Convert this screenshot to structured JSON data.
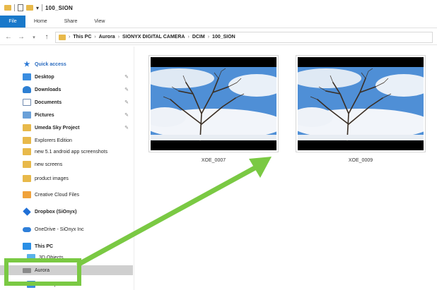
{
  "window": {
    "title": "100_SION"
  },
  "ribbon": {
    "tabs": [
      "File",
      "Home",
      "Share",
      "View"
    ]
  },
  "address": {
    "crumbs": [
      "This PC",
      "Aurora",
      "SIONYX DIGITAL CAMERA",
      "DCIM",
      "100_SION"
    ]
  },
  "sidebar": {
    "items": [
      {
        "label": "Quick access",
        "icon": "star-icon"
      },
      {
        "label": "Desktop",
        "icon": "desktop-icon",
        "pinned": true
      },
      {
        "label": "Downloads",
        "icon": "downloads-icon",
        "pinned": true
      },
      {
        "label": "Documents",
        "icon": "documents-icon",
        "pinned": true
      },
      {
        "label": "Pictures",
        "icon": "pictures-icon",
        "pinned": true
      },
      {
        "label": "Umeda Sky Project",
        "icon": "folder-icon",
        "pinned": true
      },
      {
        "label": "Explorers Edition",
        "icon": "folder-icon"
      },
      {
        "label": "new 5.1 android app screenshots",
        "icon": "folder-icon"
      },
      {
        "label": "new screens",
        "icon": "folder-icon"
      },
      {
        "label": "product images",
        "icon": "folder-icon"
      },
      {
        "label": "Creative Cloud Files",
        "icon": "creative-cloud-icon"
      },
      {
        "label": "Dropbox (SiOnyx)",
        "icon": "dropbox-icon"
      },
      {
        "label": "OneDrive - SiOnyx Inc",
        "icon": "onedrive-icon"
      },
      {
        "label": "This PC",
        "icon": "pc-icon"
      },
      {
        "label": "3D Objects",
        "icon": "3d-objects-icon"
      },
      {
        "label": "Aurora",
        "icon": "drive-icon",
        "selected": true
      },
      {
        "label": "Desktop",
        "icon": "desktop-icon"
      }
    ]
  },
  "files": [
    {
      "name": "XOE_0007"
    },
    {
      "name": "XOE_0009"
    }
  ],
  "colors": {
    "accent": "#1979ca",
    "highlight": "#7ac943",
    "selection": "#cfcfcf"
  }
}
